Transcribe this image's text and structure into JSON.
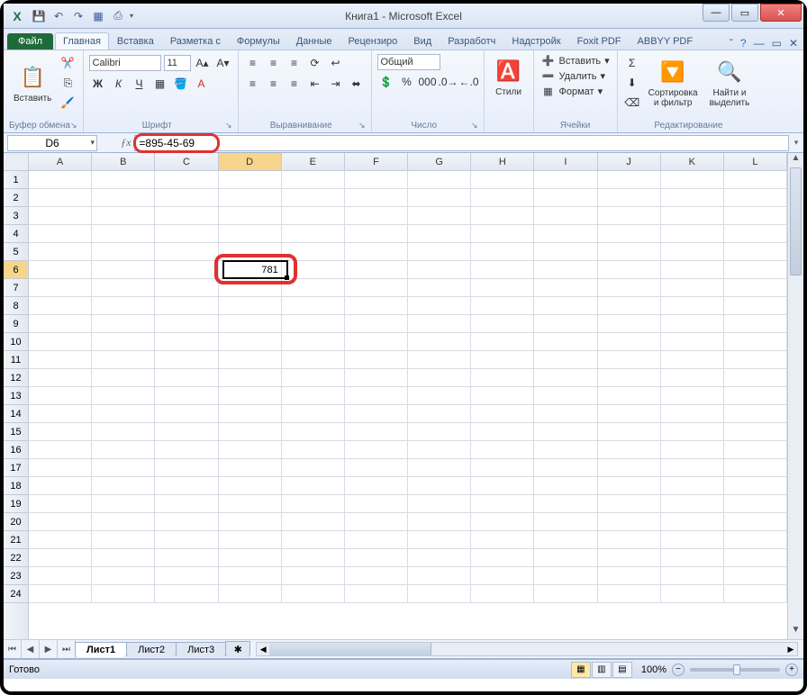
{
  "window": {
    "title": "Книга1 - Microsoft Excel"
  },
  "qat": [
    "save",
    "undo",
    "redo",
    "new",
    "print"
  ],
  "ribbon": {
    "file_label": "Файл",
    "tabs": [
      "Главная",
      "Вставка",
      "Разметка с",
      "Формулы",
      "Данные",
      "Рецензиро",
      "Вид",
      "Разработч",
      "Надстройк",
      "Foxit PDF",
      "ABBYY PDF"
    ],
    "active_tab": 0,
    "clipboard": {
      "paste": "Вставить",
      "group": "Буфер обмена"
    },
    "font": {
      "name": "Calibri",
      "size": "11",
      "group": "Шрифт"
    },
    "alignment": {
      "group": "Выравнивание"
    },
    "number": {
      "format": "Общий",
      "group": "Число"
    },
    "styles": {
      "label": "Стили",
      "group": ""
    },
    "cells": {
      "insert": "Вставить",
      "delete": "Удалить",
      "format": "Формат",
      "group": "Ячейки"
    },
    "editing": {
      "sort": "Сортировка\nи фильтр",
      "find": "Найти и\nвыделить",
      "group": "Редактирование"
    }
  },
  "namebox": "D6",
  "formula": "=895-45-69",
  "grid": {
    "columns": [
      "A",
      "B",
      "C",
      "D",
      "E",
      "F",
      "G",
      "H",
      "I",
      "J",
      "K",
      "L"
    ],
    "rows": 24,
    "selected_col": "D",
    "selected_row": 6,
    "cell_value": "781"
  },
  "sheets": {
    "tabs": [
      "Лист1",
      "Лист2",
      "Лист3"
    ],
    "active": 0
  },
  "status": {
    "ready": "Готово",
    "zoom": "100%"
  }
}
